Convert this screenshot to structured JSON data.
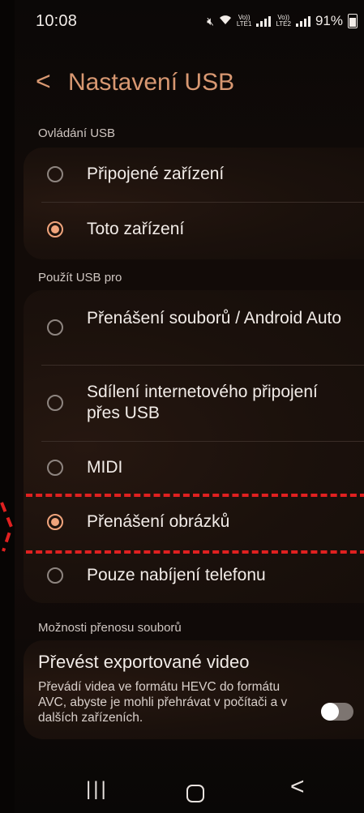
{
  "status_bar": {
    "time": "10:08",
    "battery": "91%",
    "network_1": "LTE1",
    "network_2": "LTE2",
    "volte_1": "Vo))",
    "volte_2": "Vo))"
  },
  "header": {
    "title": "Nastavení USB"
  },
  "usb_control": {
    "label": "Ovládání USB",
    "options": [
      {
        "label": "Připojené zařízení",
        "selected": false
      },
      {
        "label": "Toto zařízení",
        "selected": true
      }
    ]
  },
  "use_usb_for": {
    "label": "Použít USB pro",
    "options": [
      {
        "label": "Přenášení souborů / Android Auto",
        "selected": false
      },
      {
        "label": "Sdílení internetového připojení přes USB",
        "selected": false
      },
      {
        "label": "MIDI",
        "selected": false
      },
      {
        "label": "Přenášení obrázků",
        "selected": true
      },
      {
        "label": "Pouze nabíjení telefonu",
        "selected": false
      }
    ]
  },
  "transfer_options": {
    "label": "Možnosti přenosu souborů",
    "convert_title": "Převést exportované video",
    "convert_desc": "Převádí videa ve formátu HEVC do formátu AVC, abyste je mohli přehrávat v počítači a v dalších zařízeních.",
    "toggle_on": false
  },
  "colors": {
    "accent": "#d89872",
    "radio_selected": "#f0a47c",
    "highlight_dash": "#e02020"
  },
  "navbar": {
    "recent": "|||",
    "back": "<"
  }
}
